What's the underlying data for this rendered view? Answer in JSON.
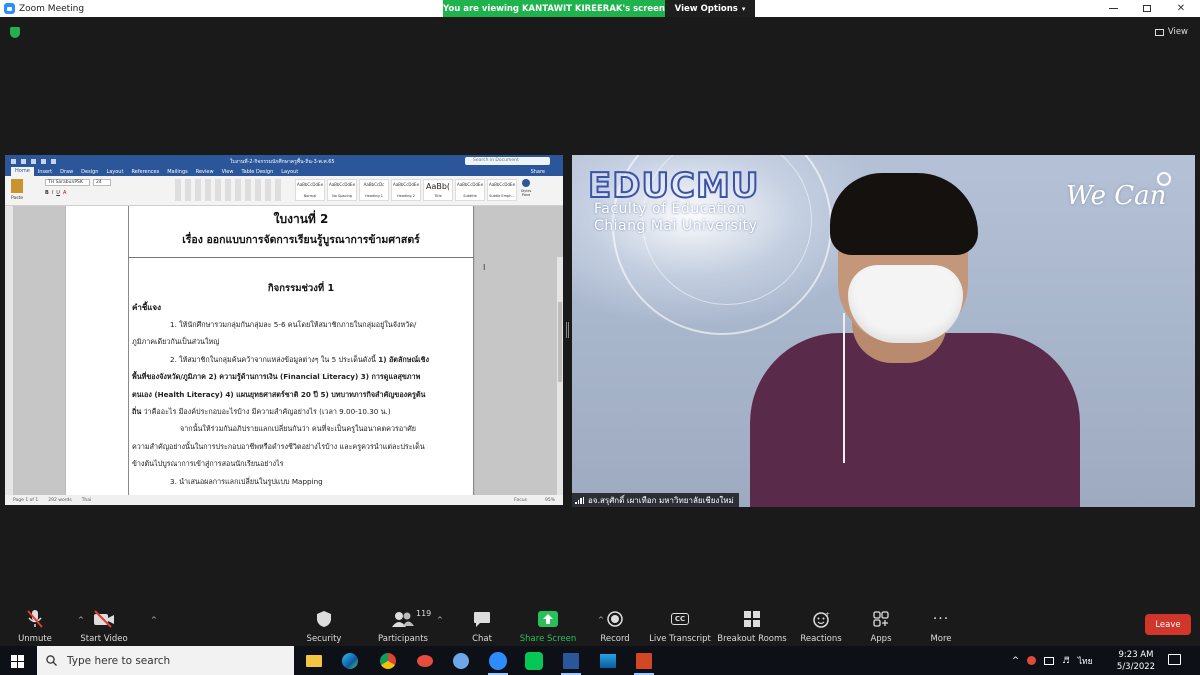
{
  "window": {
    "title": "Zoom Meeting",
    "viewing_banner": "You are viewing KANTAWIT KIREERAK's screen",
    "view_options": "View Options",
    "view_label": "View"
  },
  "word": {
    "doc_title": "ใบงานที่-2-กิจกรรมนักศึกษาครูพื้น-ถิ่น-3-พ.ศ.65",
    "search_placeholder": "Search in Document",
    "tabs": [
      "Home",
      "Insert",
      "Draw",
      "Design",
      "Layout",
      "References",
      "Mailings",
      "Review",
      "View",
      "Table Design",
      "Layout"
    ],
    "share_label": "Share",
    "paste_label": "Paste",
    "font_name": "TH SarabunPSK",
    "font_size": "24",
    "styles": [
      {
        "preview": "AaBbCcDdEe",
        "name": "Normal"
      },
      {
        "preview": "AaBbCcDdEe",
        "name": "No Spacing"
      },
      {
        "preview": "AaBbCcDc",
        "name": "Heading 1"
      },
      {
        "preview": "AaBbCcDdEe",
        "name": "Heading 2"
      },
      {
        "preview": "AaBb(",
        "name": "Title"
      },
      {
        "preview": "AaBbCcDdEe",
        "name": "Subtitle"
      },
      {
        "preview": "AaBbCcDdEe",
        "name": "Subtle Emph..."
      }
    ],
    "styles_pane": "Styles Pane",
    "page": {
      "heading1": "ใบงานที่ 2",
      "heading2": "เรื่อง  ออกแบบการจัดการเรียนรู้บูรณาการข้ามศาสตร์",
      "activity": "กิจกรรมช่วงที่ 1",
      "instructions": "คำชี้แจง",
      "line1": "1.  ให้นักศึกษารวมกลุ่มกันกลุ่มละ 5-6 คนโดยให้สมาชิกภายในกลุ่มอยู่ในจังหวัด/",
      "line2": "ภูมิภาคเดียวกันเป็นส่วนใหญ่",
      "line3a": "2.  ให้สมาชิกในกลุ่มค้นคว้าจากแหล่งข้อมูลต่างๆ ใน 5 ประเด็นดังนี้ ",
      "line3b": "1) อัตลักษณ์เชิง",
      "line4": "พื้นที่ของจังหวัด/ภูมิภาค  2) ความรู้ด้านการเงิน (Financial Literacy) 3)  การดูแลสุขภาพ",
      "line5": "ตนเอง (Health Literacy)  4) แผนยุทธศาสตร์ชาติ 20 ปี  5) บทบาทภารกิจสำคัญของครูต้น",
      "line6a": "ถิ่น",
      "line6b": " ว่าคืออะไร มีองค์ประกอบอะไรบ้าง มีความสำคัญอย่างไร  (เวลา 9.00-10.30 น.)",
      "line7": "จากนั้นให้ร่วมกันอภิปรายแลกเปลี่ยนกันว่า คนที่จะเป็นครูในอนาคตควรอาศัย",
      "line8": "ความสำคัญอย่างนั้นในการประกอบอาชีพหรือดำรงชีวิตอย่างไรบ้าง และครูควรนำแต่ละประเด็น",
      "line9": "ข้างต้นไปบูรณาการเข้าสู่การสอนนักเรียนอย่างไร",
      "line10": "3. นำเสนอผลการแลกเปลี่ยนในรูปแบบ Mapping"
    },
    "status": {
      "page": "Page 1 of 1",
      "words": "292 words",
      "lang": "Thai",
      "focus": "Focus",
      "zoom": "95%"
    }
  },
  "video": {
    "logo": "EDUCMU",
    "faculty_line1": "Faculty of Education",
    "faculty_line2": "Chiang Mai University",
    "brand": "We Can",
    "participant_name": "อจ.สรุศักดิ์ เผาเทือก มหาวิทยาลัยเชียงใหม่"
  },
  "toolbar": {
    "unmute": "Unmute",
    "start_video": "Start Video",
    "security": "Security",
    "participants": "Participants",
    "participants_count": "119",
    "chat": "Chat",
    "share_screen": "Share Screen",
    "record": "Record",
    "live_transcript": "Live Transcript",
    "breakout_rooms": "Breakout Rooms",
    "reactions": "Reactions",
    "apps": "Apps",
    "more": "More",
    "leave": "Leave",
    "cc": "CC"
  },
  "taskbar": {
    "search_placeholder": "Type here to search",
    "lang": "ไทย",
    "time": "9:23 AM",
    "date": "5/3/2022"
  },
  "colors": {
    "zoom_blue": "#2d8cff",
    "banner_green": "#1fb34d",
    "leave_red": "#d0362a",
    "word_blue": "#2b579a"
  }
}
